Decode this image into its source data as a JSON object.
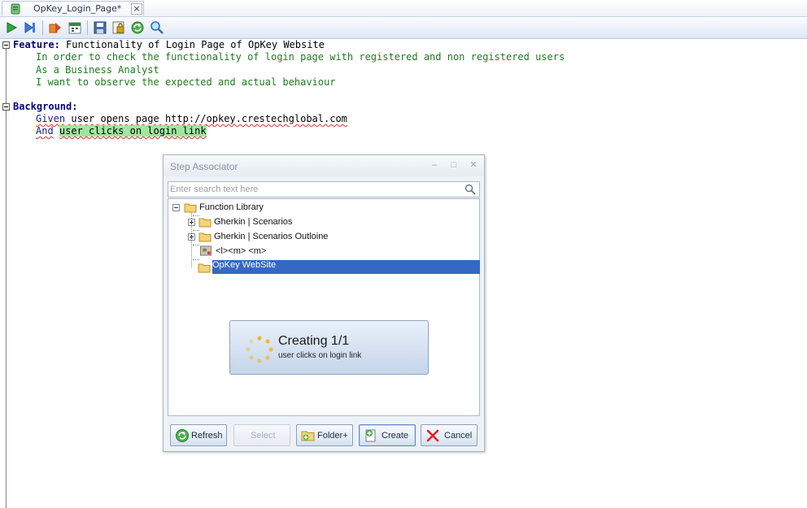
{
  "tab": {
    "title": "OpKey_Login_Page*",
    "close": "×"
  },
  "toolbar": {
    "icons": [
      "run-icon",
      "step-run-icon",
      "export-icon",
      "calendar-icon",
      "save-icon",
      "lock-icon",
      "refresh-icon",
      "search-icon"
    ]
  },
  "editor": {
    "feature_keyword": "Feature:",
    "feature_title": " Functionality of Login Page of OpKey Website",
    "narrative": [
      "In order to check the functionality of login page with registered and non registered users",
      "As a Business Analyst",
      "I want to observe the expected and actual behaviour"
    ],
    "background_keyword": "Background:",
    "given_keyword": "Given",
    "given_text": " user opens page http://opkey.crestechglobal.com",
    "and_keyword": "And",
    "and_text": "user clicks on login link"
  },
  "dialog": {
    "title": "Step Associator",
    "minimize": "–",
    "maximize": "□",
    "close": "✕",
    "search_placeholder": "Enter search text here",
    "tree": {
      "root": "Function Library",
      "items": [
        "Gherkin | Scenarios",
        "Gherkin | Scenarios Outloine",
        "<l><m> <m>",
        "OpKey WebSite"
      ],
      "selected": "OpKey WebSite"
    },
    "progress": {
      "title": "Creating 1/1",
      "subtitle": "user clicks on login link"
    },
    "buttons": {
      "refresh": "Refresh",
      "select": "Select",
      "folder": "Folder+",
      "create": "Create",
      "cancel": "Cancel"
    }
  },
  "colors": {
    "keyword": "#000080",
    "narrative": "#1e7d1e",
    "highlight": "#9fe79f",
    "selection": "#3568c3"
  }
}
